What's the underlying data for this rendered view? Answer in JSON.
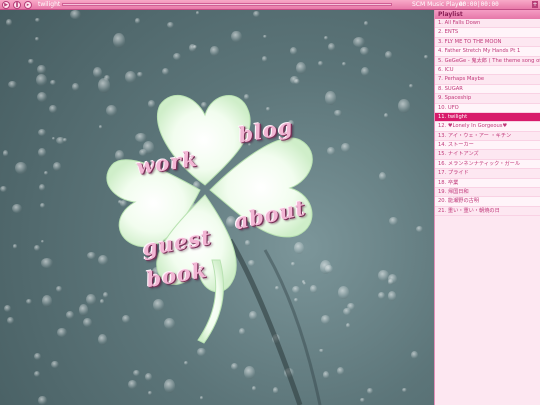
{
  "player": {
    "track": "twilight",
    "app_name": "SCM Music Player",
    "time": "00:00|00:00",
    "plus_label": "+",
    "progress": 0.0,
    "play_icon": "play-icon",
    "pause_icon": "pause-icon",
    "next_icon": "next-icon"
  },
  "nav": {
    "blog": "blog",
    "work": "work",
    "about": "about",
    "guestbook_line1": "guest",
    "guestbook_line2": "book"
  },
  "playlist": {
    "header": "Playlist",
    "items": [
      "1. All Falls Down",
      "2. ENTS",
      "3. FLY ME TO THE MOON",
      "4. Father Stretch My Hands Pt 1",
      "5. GeGeGe - 鬼太郎 ( The theme song of mo",
      "6. ICU",
      "7. Perhaps Maybe",
      "8. SUGAR",
      "9. Spaceship",
      "10. UFO",
      "11. twilight",
      "12. ♥Lonely In Gorgeous♥",
      "13. アイ・ウェ・アー ・キチン",
      "14. ストーカー",
      "15. ナイトアンズ",
      "16. メランネンナティック・ガール",
      "17. プライド",
      "18. 卒業",
      "19. 帰国日和",
      "20. 能瀬野の古明",
      "21. 重い・重い・朝焼の日"
    ],
    "active_index": 10
  },
  "colors": {
    "accent": "#d81b6b",
    "bar_pink": "#e879a8",
    "clover_green": "#e9fbe4"
  }
}
